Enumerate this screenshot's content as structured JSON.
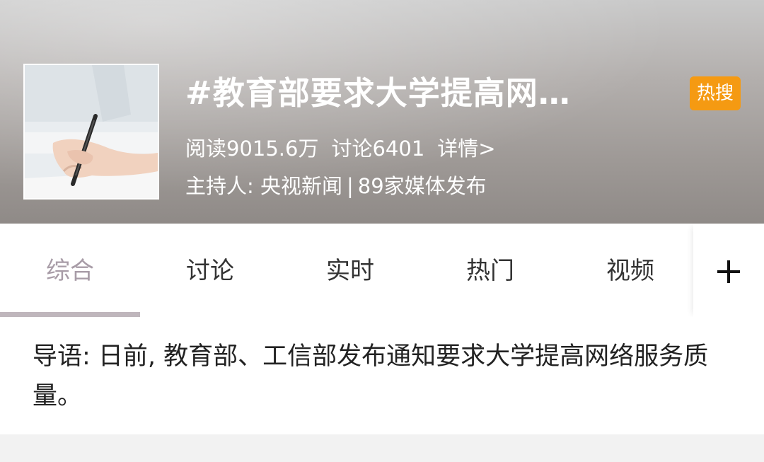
{
  "topic": {
    "title": "#教育部要求大学提高网…",
    "hot_badge": "热搜",
    "stats": {
      "reads": "阅读9015.6万",
      "discussions": "讨论6401",
      "details": "详情>"
    },
    "host": {
      "label": "主持人: 央视新闻",
      "separator": "|",
      "media": "89家媒体发布"
    }
  },
  "tabs": [
    {
      "label": "综合",
      "active": true
    },
    {
      "label": "讨论",
      "active": false
    },
    {
      "label": "实时",
      "active": false
    },
    {
      "label": "热门",
      "active": false
    },
    {
      "label": "视频",
      "active": false
    }
  ],
  "intro": {
    "text": "导语: 日前, 教育部、工信部发布通知要求大学提高网络服务质量。"
  },
  "colors": {
    "hot_badge": "#f59a12",
    "active_tab": "#a89ca7",
    "header_bg": "#9f9a97"
  },
  "icons": {
    "add": "plus-icon"
  }
}
